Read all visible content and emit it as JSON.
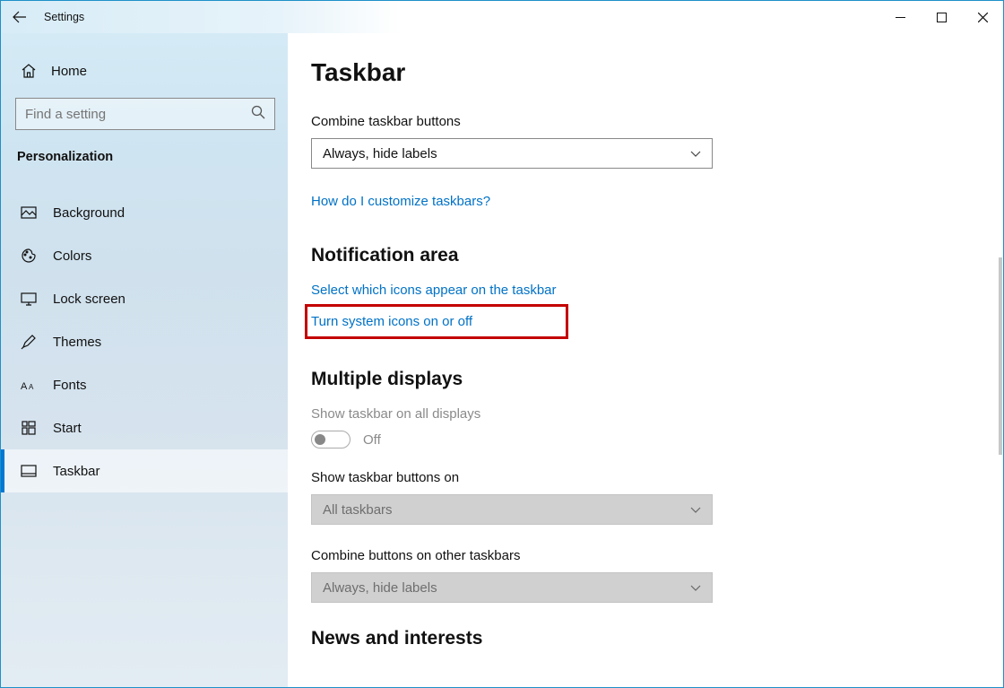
{
  "window": {
    "title": "Settings"
  },
  "sidebar": {
    "home_label": "Home",
    "search_placeholder": "Find a setting",
    "category_label": "Personalization",
    "items": [
      {
        "label": "Background"
      },
      {
        "label": "Colors"
      },
      {
        "label": "Lock screen"
      },
      {
        "label": "Themes"
      },
      {
        "label": "Fonts"
      },
      {
        "label": "Start"
      },
      {
        "label": "Taskbar"
      }
    ],
    "selected_index": 6
  },
  "main": {
    "page_title": "Taskbar",
    "combine_label": "Combine taskbar buttons",
    "combine_value": "Always, hide labels",
    "help_link": "How do I customize taskbars?",
    "section_notification": "Notification area",
    "link_select_icons": "Select which icons appear on the taskbar",
    "link_system_icons": "Turn system icons on or off",
    "section_displays": "Multiple displays",
    "show_all_displays_label": "Show taskbar on all displays",
    "show_all_displays_state": "Off",
    "show_buttons_on_label": "Show taskbar buttons on",
    "show_buttons_on_value": "All taskbars",
    "combine_other_label": "Combine buttons on other taskbars",
    "combine_other_value": "Always, hide labels",
    "section_news": "News and interests"
  }
}
